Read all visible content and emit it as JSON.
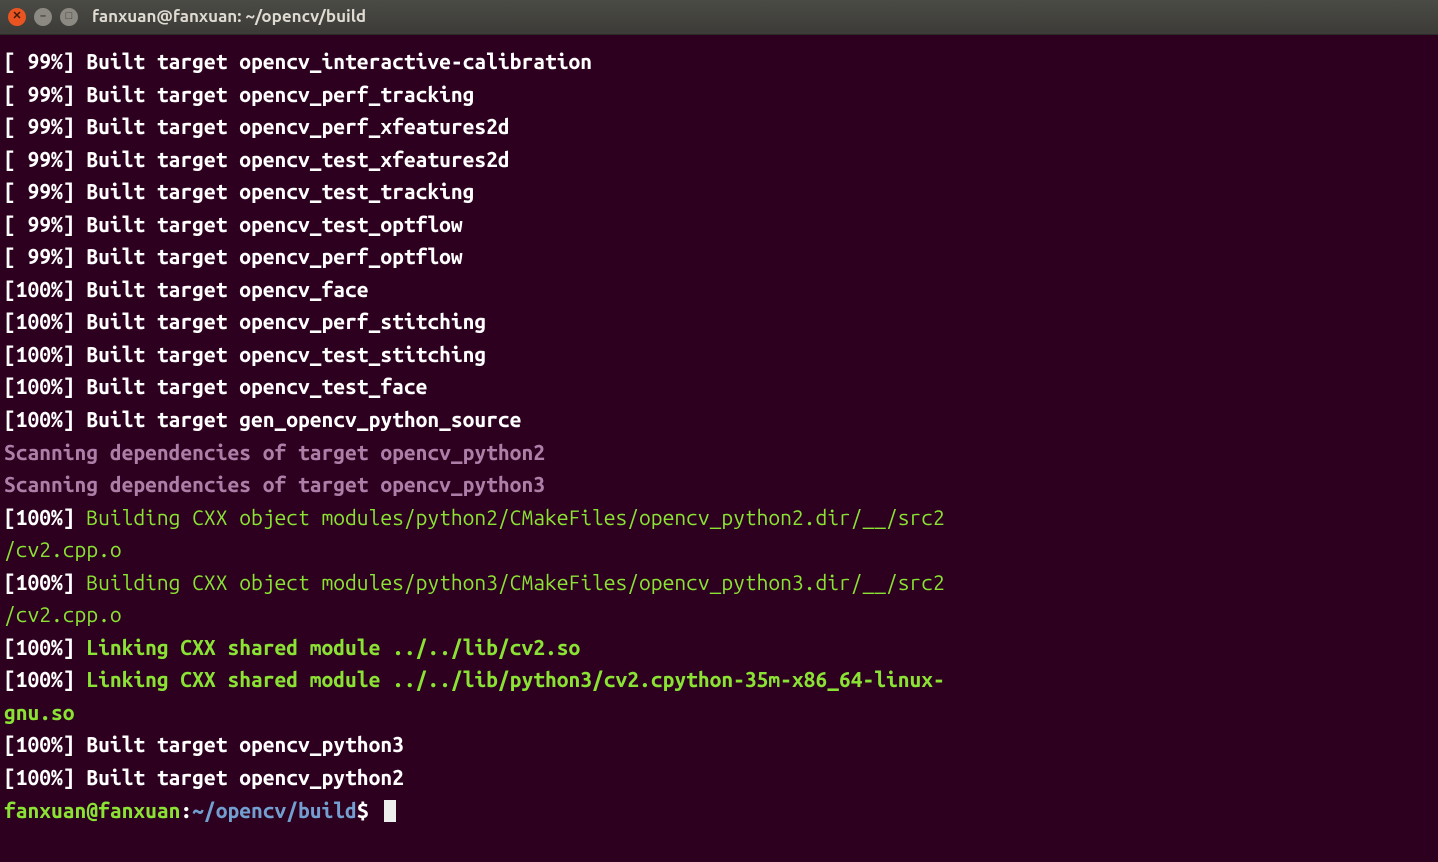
{
  "window": {
    "title": "fanxuan@fanxuan: ~/opencv/build"
  },
  "lines": [
    {
      "percent": "[ 99%]",
      "class": "white",
      "text": "Built target opencv_interactive-calibration"
    },
    {
      "percent": "[ 99%]",
      "class": "white",
      "text": "Built target opencv_perf_tracking"
    },
    {
      "percent": "[ 99%]",
      "class": "white",
      "text": "Built target opencv_perf_xfeatures2d"
    },
    {
      "percent": "[ 99%]",
      "class": "white",
      "text": "Built target opencv_test_xfeatures2d"
    },
    {
      "percent": "[ 99%]",
      "class": "white",
      "text": "Built target opencv_test_tracking"
    },
    {
      "percent": "[ 99%]",
      "class": "white",
      "text": "Built target opencv_test_optflow"
    },
    {
      "percent": "[ 99%]",
      "class": "white",
      "text": "Built target opencv_perf_optflow"
    },
    {
      "percent": "[100%]",
      "class": "white",
      "text": "Built target opencv_face"
    },
    {
      "percent": "[100%]",
      "class": "white",
      "text": "Built target opencv_perf_stitching"
    },
    {
      "percent": "[100%]",
      "class": "white",
      "text": "Built target opencv_test_stitching"
    },
    {
      "percent": "[100%]",
      "class": "white",
      "text": "Built target opencv_test_face"
    },
    {
      "percent": "[100%]",
      "class": "white",
      "text": "Built target gen_opencv_python_source"
    },
    {
      "full": "Scanning dependencies of target opencv_python2",
      "class": "magenta"
    },
    {
      "full": "Scanning dependencies of target opencv_python3",
      "class": "magenta"
    },
    {
      "percent": "[100%]",
      "class": "lgreen",
      "text": "Building CXX object modules/python2/CMakeFiles/opencv_python2.dir/__/src2"
    },
    {
      "full": "/cv2.cpp.o",
      "class": "lgreen"
    },
    {
      "percent": "[100%]",
      "class": "lgreen",
      "text": "Building CXX object modules/python3/CMakeFiles/opencv_python3.dir/__/src2"
    },
    {
      "full": "/cv2.cpp.o",
      "class": "lgreen"
    },
    {
      "percent": "[100%]",
      "class": "green",
      "text": "Linking CXX shared module ../../lib/cv2.so"
    },
    {
      "percent": "[100%]",
      "class": "green",
      "text": "Linking CXX shared module ../../lib/python3/cv2.cpython-35m-x86_64-linux-"
    },
    {
      "full": "gnu.so",
      "class": "green"
    },
    {
      "percent": "[100%]",
      "class": "white",
      "text": "Built target opencv_python3"
    },
    {
      "percent": "[100%]",
      "class": "white",
      "text": "Built target opencv_python2"
    }
  ],
  "prompt": {
    "userhost": "fanxuan@fanxuan",
    "colon": ":",
    "path": "~/opencv/build",
    "dollar": "$"
  }
}
